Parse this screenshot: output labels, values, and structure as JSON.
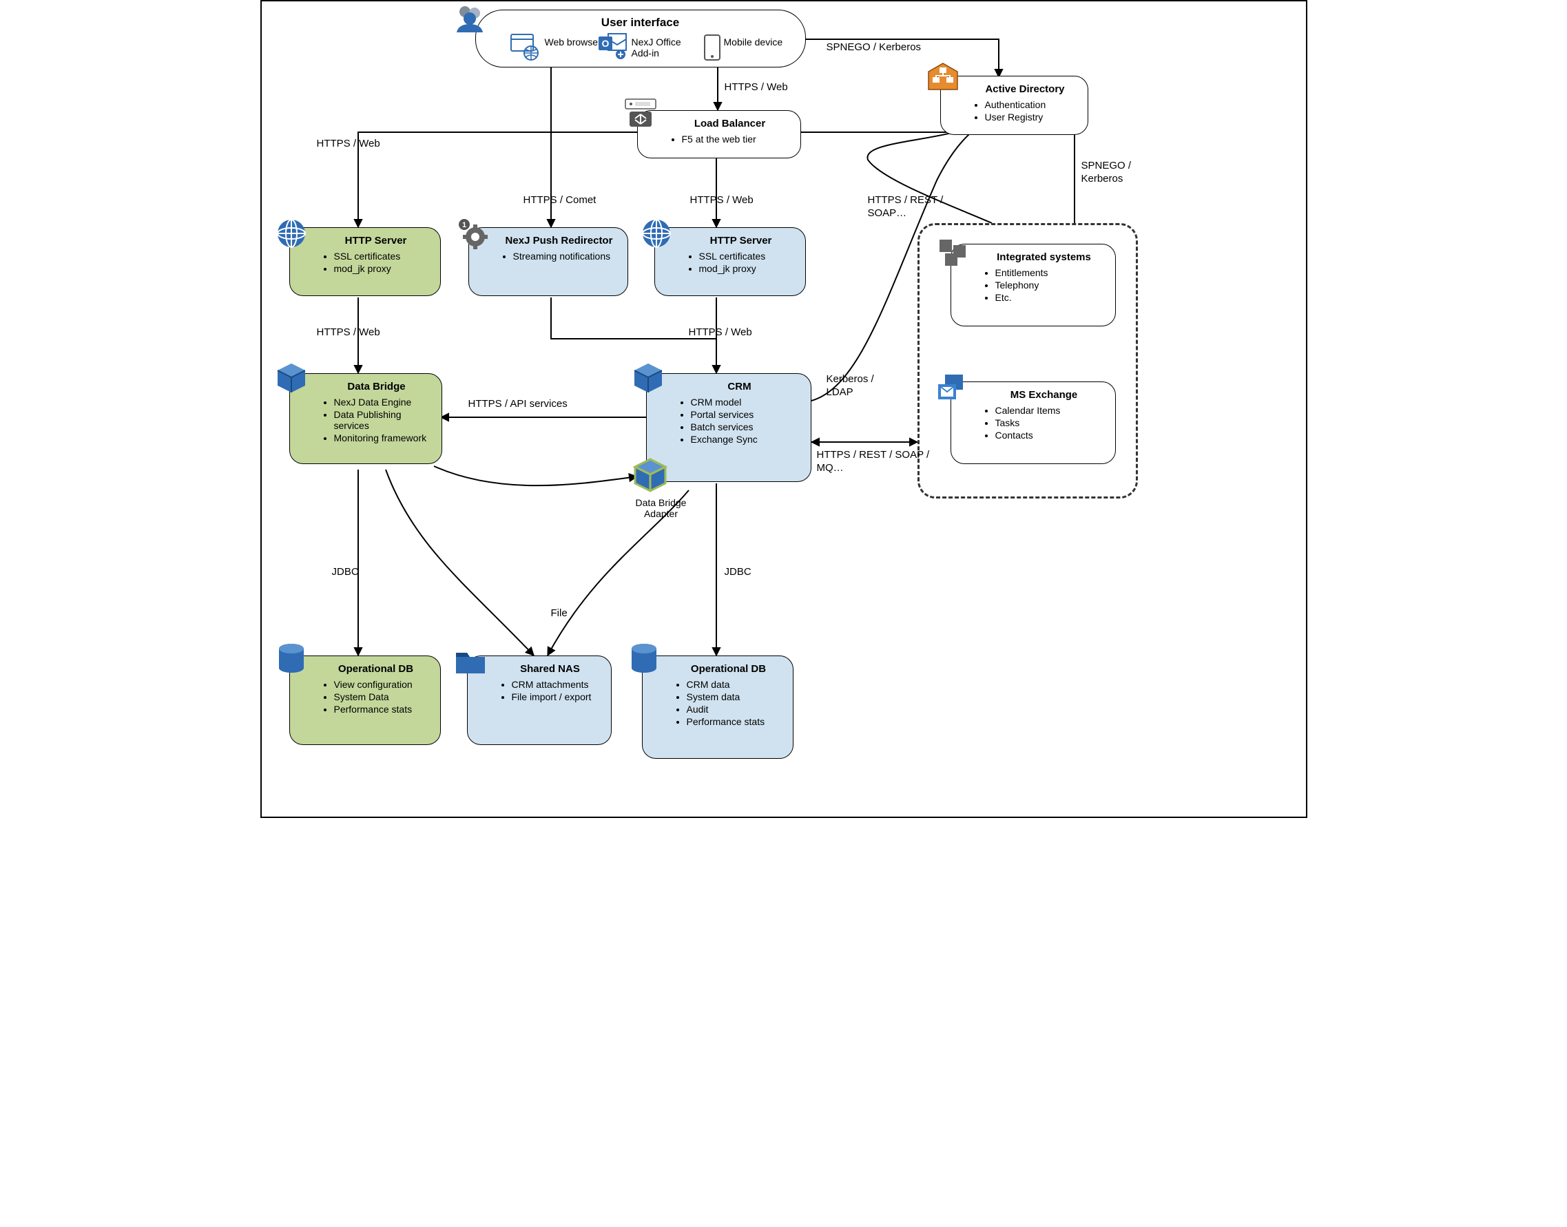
{
  "ui": {
    "title": "User interface",
    "items": [
      {
        "label": "Web\nbrowser"
      },
      {
        "label": "NexJ Office\nAdd-in"
      },
      {
        "label": "Mobile\ndevice"
      }
    ]
  },
  "nodes": {
    "load_balancer": {
      "title": "Load Balancer",
      "bullets": [
        "F5 at the web tier"
      ]
    },
    "active_directory": {
      "title": "Active Directory",
      "bullets": [
        "Authentication",
        "User Registry"
      ]
    },
    "http_server_left": {
      "title": "HTTP Server",
      "bullets": [
        "SSL certificates",
        "mod_jk proxy"
      ]
    },
    "push_redirector": {
      "title": "NexJ Push Redirector",
      "bullets": [
        "Streaming notifications"
      ]
    },
    "http_server_right": {
      "title": "HTTP Server",
      "bullets": [
        "SSL certificates",
        "mod_jk proxy"
      ]
    },
    "data_bridge": {
      "title": "Data Bridge",
      "bullets": [
        "NexJ Data Engine",
        "Data Publishing services",
        "Monitoring framework"
      ]
    },
    "crm": {
      "title": "CRM",
      "bullets": [
        "CRM model",
        "Portal services",
        "Batch services",
        "Exchange Sync"
      ]
    },
    "op_db_left": {
      "title": "Operational DB",
      "bullets": [
        "View configuration",
        "System Data",
        "Performance stats"
      ]
    },
    "shared_nas": {
      "title": "Shared NAS",
      "bullets": [
        "CRM attachments",
        "File import / export"
      ]
    },
    "op_db_right": {
      "title": "Operational DB",
      "bullets": [
        "CRM data",
        "System data",
        "Audit",
        "Performance stats"
      ]
    },
    "integrated": {
      "title": "Integrated systems",
      "bullets": [
        "Entitlements",
        "Telephony",
        "Etc."
      ]
    },
    "ms_exchange": {
      "title": "MS Exchange",
      "bullets": [
        "Calendar Items",
        "Tasks",
        "Contacts"
      ]
    }
  },
  "data_bridge_adapter": "Data Bridge\nAdapter",
  "edges": {
    "spnego_top": "SPNEGO / Kerberos",
    "https_web_ui_lb": "HTTPS / Web",
    "https_web_left": "HTTPS / Web",
    "https_comet": "HTTPS / Comet",
    "https_web_lb_http": "HTTPS / Web",
    "https_rest_soap": "HTTPS / REST /\nSOAP…",
    "spnego_right": "SPNEGO /\nKerberos",
    "https_web_mid": "HTTPS / Web",
    "https_api": "HTTPS / API services",
    "kerberos_ldap": "Kerberos /\nLDAP",
    "https_rest_soap_mq": "HTTPS / REST / SOAP /\nMQ…",
    "jdbc_left": "JDBC",
    "jdbc_right": "JDBC",
    "file": "File"
  },
  "colors": {
    "green": "#c3d79b",
    "blue": "#d0e2ef",
    "accent_blue": "#2f6cb4",
    "accent_orange": "#e78b2f"
  }
}
